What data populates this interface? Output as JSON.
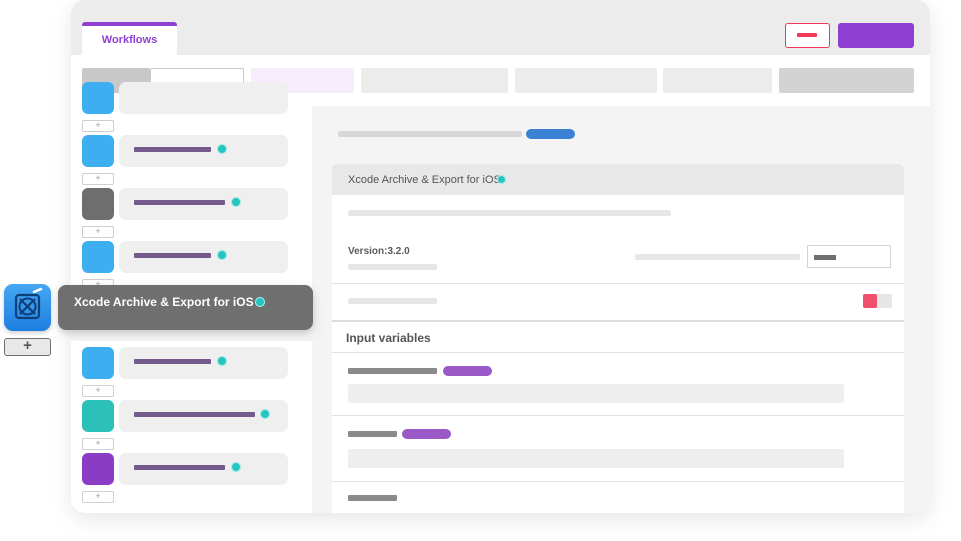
{
  "header": {
    "tabs": [
      {
        "label": "Workflows",
        "active": true
      }
    ],
    "accent_color": "#8e3fd1",
    "discard_color": "#f0385a"
  },
  "sidebar": {
    "steps": [
      {
        "icon_color": "#3daef0"
      },
      {
        "icon_color": "#3daef0"
      },
      {
        "icon_color": "#6e6e6e"
      },
      {
        "icon_color": "#3daef0"
      },
      {
        "icon_color": "#3daef0"
      },
      {
        "icon_color": "#2cc1b8"
      },
      {
        "icon_color": "#8a3cc4"
      }
    ],
    "add_step_label": "+"
  },
  "dragged_step": {
    "title": "Xcode Archive & Export for iOS",
    "icon": "xcode-icon",
    "add_label": "+"
  },
  "step_detail": {
    "title": "Xcode Archive & Export for iOS",
    "version": "Version:3.2.0",
    "section_title": "Input variables"
  }
}
